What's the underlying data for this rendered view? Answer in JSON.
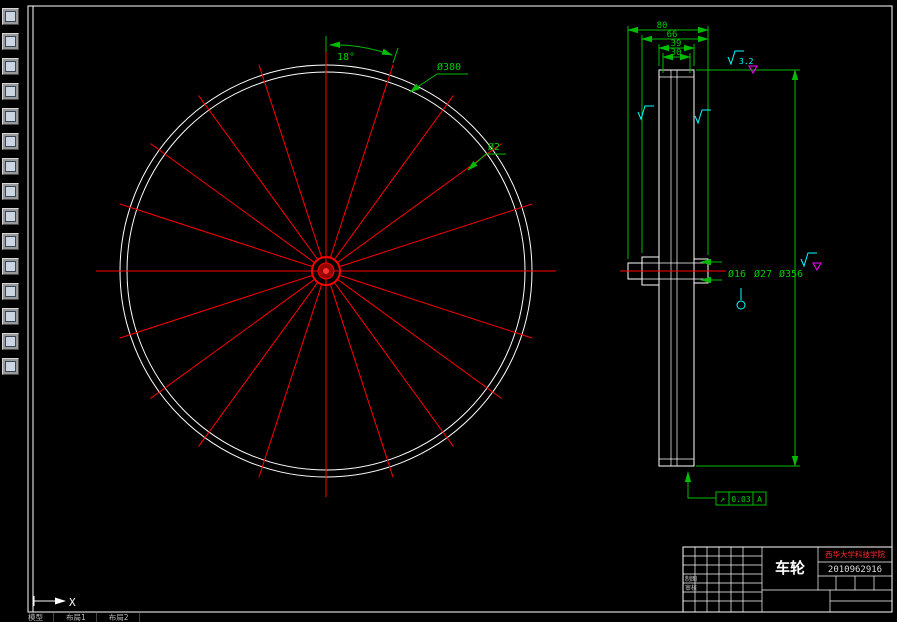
{
  "app": {
    "toolbar_icons": [
      "cad-tool-icon-1",
      "cad-tool-icon-2",
      "cad-tool-icon-3",
      "cad-tool-icon-4",
      "cad-tool-icon-5",
      "cad-tool-icon-6",
      "cad-tool-icon-7",
      "cad-tool-icon-8",
      "cad-tool-icon-9",
      "cad-tool-icon-10",
      "cad-tool-icon-11",
      "cad-tool-icon-12",
      "cad-tool-icon-13",
      "cad-tool-icon-14",
      "cad-tool-icon-15"
    ]
  },
  "colors": {
    "geometry": "#ffffff",
    "centerline": "#ff0000",
    "dimension": "#00bb00",
    "annotation_cyan": "#00ffff",
    "annotation_magenta": "#ff00ff"
  },
  "drawing": {
    "front_view": {
      "spoke_count": 20,
      "angle_dim": "18°",
      "diameter_dim": "Ø380",
      "spoke_dim": "Ø2"
    },
    "side_view": {
      "width_dims": [
        "80",
        "66",
        "39",
        "30"
      ],
      "diameter_dims": [
        "Ø16",
        "Ø27",
        "Ø356"
      ],
      "roughness": "3.2",
      "tolerance_symbol": "↗",
      "tolerance_value": "0.03",
      "tolerance_datum": "A"
    }
  },
  "title_block": {
    "part_name": "车轮",
    "organization": "西华大学科技学院",
    "drawing_number": "2010962916",
    "field_labels": {
      "draft": "制图",
      "check": "审核"
    }
  },
  "status_bar": {
    "tabs": [
      "模型",
      "布局1",
      "布局2"
    ]
  },
  "ucs": {
    "x_label": "X"
  }
}
